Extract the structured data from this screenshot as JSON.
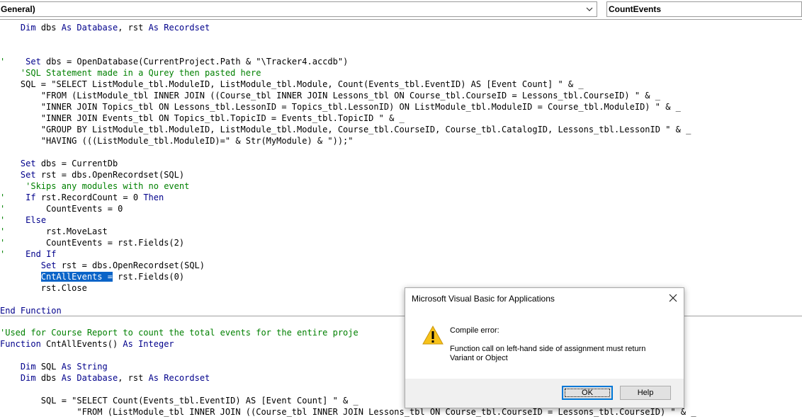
{
  "header": {
    "object_combo": "General)",
    "procedure_combo": "CountEvents"
  },
  "code_top": [
    {
      "text": "    Dim dbs As Database, rst As Recordset"
    },
    {
      "text": ""
    },
    {
      "text": ""
    },
    {
      "text": "'    Set dbs = OpenDatabase(CurrentProject.Path & \"\\Tracker4.accdb\")"
    },
    {
      "text": "    'SQL Statement made in a Qurey then pasted here"
    },
    {
      "text": "    SQL = \"SELECT ListModule_tbl.ModuleID, ListModule_tbl.Module, Count(Events_tbl.EventID) AS [Event Count] \" & _"
    },
    {
      "text": "        \"FROM (ListModule_tbl INNER JOIN ((Course_tbl INNER JOIN Lessons_tbl ON Course_tbl.CourseID = Lessons_tbl.CourseID) \" & _"
    },
    {
      "text": "        \"INNER JOIN Topics_tbl ON Lessons_tbl.LessonID = Topics_tbl.LessonID) ON ListModule_tbl.ModuleID = Course_tbl.ModuleID) \" & _"
    },
    {
      "text": "        \"INNER JOIN Events_tbl ON Topics_tbl.TopicID = Events_tbl.TopicID \" & _"
    },
    {
      "text": "        \"GROUP BY ListModule_tbl.ModuleID, ListModule_tbl.Module, Course_tbl.CourseID, Course_tbl.CatalogID, Lessons_tbl.LessonID \" & _"
    },
    {
      "text": "        \"HAVING (((ListModule_tbl.ModuleID)=\" & Str(MyModule) & \"));\""
    },
    {
      "text": ""
    },
    {
      "text": "    Set dbs = CurrentDb"
    },
    {
      "text": "    Set rst = dbs.OpenRecordset(SQL)"
    },
    {
      "text": "     'Skips any modules with no event"
    },
    {
      "text": "'    If rst.RecordCount = 0 Then"
    },
    {
      "text": "'        CountEvents = 0"
    },
    {
      "text": "'    Else"
    },
    {
      "text": "'        rst.MoveLast"
    },
    {
      "text": "'        CountEvents = rst.Fields(2)"
    },
    {
      "text": "'    End If"
    },
    {
      "text": "        Set rst = dbs.OpenRecordset(SQL)"
    },
    {
      "text": "        CntAllEvents = rst.Fields(0)"
    },
    {
      "text": "        rst.Close"
    },
    {
      "text": ""
    },
    {
      "text": "End Function"
    }
  ],
  "code_bottom": [
    {
      "text": "'Used for Course Report to count the total events for the entire proje"
    },
    {
      "text": "Function CntAllEvents() As Integer"
    },
    {
      "text": ""
    },
    {
      "text": "    Dim SQL As String"
    },
    {
      "text": "    Dim dbs As Database, rst As Recordset"
    },
    {
      "text": ""
    },
    {
      "text": "        SQL = \"SELECT Count(Events_tbl.EventID) AS [Event Count] \" & _"
    },
    {
      "text": "               \"FROM (ListModule_tbl INNER JOIN ((Course_tbl INNER JOIN Lessons_tbl ON Course_tbl.CourseID = Lessons_tbl.CourseID) \" & _"
    }
  ],
  "selection": {
    "text": "CntAllEvents ="
  },
  "dialog": {
    "title": "Microsoft Visual Basic for Applications",
    "heading": "Compile error:",
    "message": "Function call on left-hand side of assignment must return Variant or Object",
    "ok_label": "OK",
    "help_label": "Help",
    "icon": "warning-icon",
    "icon_color": "#f7c21a"
  }
}
